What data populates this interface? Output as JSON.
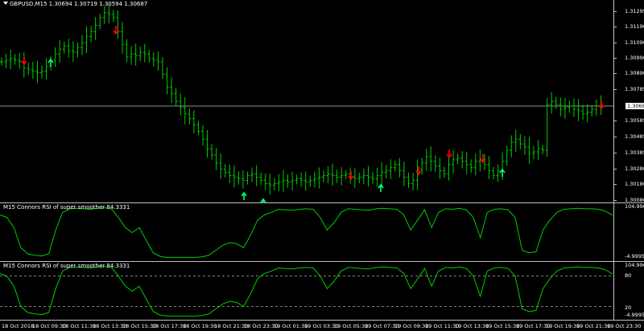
{
  "main_chart": {
    "title": "GBPUSD,M15  1.30694 1.30719 1.30594 1.30687",
    "current_price": "1.30687",
    "y_ticks": [
      "1.31295",
      "1.31190",
      "1.31090",
      "1.30990",
      "1.30890",
      "1.30785",
      "1.30687",
      "1.30585",
      "1.30485",
      "1.30385",
      "1.30280",
      "1.30180",
      "1.30080"
    ],
    "colors": {
      "bars": "#00cc00",
      "sell_arrow": "#ff0000",
      "buy_arrow": "#00ff7f",
      "price_line": "#c0c0c0"
    }
  },
  "indicator_1": {
    "title": "M15 Connors RSI of super smoother 84.3331",
    "y_ticks": [
      "104.9966",
      "-4.9995"
    ],
    "color": "#00cc00"
  },
  "indicator_2": {
    "title": "M15 Connors RSI of super smoother 84.3331",
    "y_ticks": [
      "104.9966",
      "80",
      "20",
      "-4.9995"
    ],
    "color": "#00cc00"
  },
  "x_axis": {
    "labels": [
      "18 Oct 2018",
      "18 Oct 09:30",
      "18 Oct 11:30",
      "18 Oct 13:30",
      "18 Oct 15:30",
      "18 Oct 17:30",
      "18 Oct 19:30",
      "18 Oct 21:30",
      "18 Oct 23:30",
      "19 Oct 01:30",
      "19 Oct 03:30",
      "19 Oct 05:30",
      "19 Oct 07:30",
      "19 Oct 09:30",
      "19 Oct 11:30",
      "19 Oct 13:30",
      "19 Oct 15:30",
      "19 Oct 17:30",
      "19 Oct 19:30",
      "19 Oct 21:30",
      "19 Oct 23:30"
    ]
  },
  "chart_data": [
    {
      "type": "ohlc",
      "series": [
        {
          "name": "GBPUSD,M15",
          "values": [
            1.3096,
            1.3097,
            1.3098,
            1.3097,
            1.3096,
            1.3092,
            1.3091,
            1.309,
            1.3089,
            1.309,
            1.3093,
            1.3097,
            1.3101,
            1.3104,
            1.3106,
            1.3103,
            1.3102,
            1.3105,
            1.3108,
            1.3112,
            1.3115,
            1.3119,
            1.3124,
            1.3127,
            1.3126,
            1.3124,
            1.3115,
            1.3107,
            1.3099,
            1.3101,
            1.31,
            1.3102,
            1.3101,
            1.3098,
            1.3097,
            1.3096,
            1.3088,
            1.308,
            1.3076,
            1.3071,
            1.3067,
            1.3063,
            1.306,
            1.3056,
            1.3052,
            1.3047,
            1.3041,
            1.3037,
            1.3032,
            1.3028,
            1.3026,
            1.3024,
            1.3023,
            1.3022,
            1.3021,
            1.3024,
            1.3025,
            1.3023,
            1.3021,
            1.3019,
            1.3018,
            1.3019,
            1.302,
            1.3021,
            1.302,
            1.3021,
            1.3022,
            1.3021,
            1.302,
            1.3021,
            1.3022,
            1.3023,
            1.3024,
            1.3025,
            1.3024,
            1.3023,
            1.3024,
            1.3025,
            1.3023,
            1.3022,
            1.3023,
            1.3024,
            1.3023,
            1.3022,
            1.3024,
            1.3026,
            1.3027,
            1.3029,
            1.3031,
            1.3027,
            1.3023,
            1.3019,
            1.3021,
            1.3028,
            1.3032,
            1.3036,
            1.3033,
            1.303,
            1.3027,
            1.3025,
            1.3031,
            1.3034,
            1.3035,
            1.3033,
            1.3031,
            1.3029,
            1.3033,
            1.3034,
            1.3031,
            1.3027,
            1.3024,
            1.3027,
            1.3033,
            1.304,
            1.3045,
            1.3047,
            1.3044,
            1.3042,
            1.3038,
            1.3039,
            1.3041,
            1.304,
            1.3069,
            1.3071,
            1.3069,
            1.3066,
            1.3067,
            1.3068,
            1.3066,
            1.3065,
            1.3063,
            1.3064,
            1.3066,
            1.3068,
            1.3069
          ]
        }
      ]
    },
    {
      "type": "line",
      "series": [
        {
          "name": "M15 Connors RSI of super smoother",
          "values": [
            85,
            80,
            60,
            20,
            8,
            5,
            4,
            8,
            55,
            90,
            97,
            98,
            97,
            96,
            98,
            99,
            97,
            80,
            60,
            50,
            60,
            35,
            10,
            3,
            1,
            1,
            1,
            1,
            1,
            2,
            5,
            15,
            25,
            30,
            28,
            20,
            45,
            75,
            85,
            90,
            96,
            95,
            94,
            96,
            97,
            96,
            80,
            55,
            70,
            90,
            97,
            96,
            95,
            94,
            97,
            98,
            97,
            96,
            85,
            55,
            75,
            95,
            60,
            90,
            97,
            96,
            98,
            95,
            80,
            40,
            90,
            96,
            97,
            95,
            80,
            15,
            10,
            12,
            55,
            75,
            90,
            96,
            97,
            98,
            97,
            97,
            96,
            92,
            84
          ]
        }
      ]
    },
    {
      "type": "line",
      "series": [
        {
          "name": "M15 Connors RSI of super smoother",
          "values": [
            85,
            80,
            60,
            20,
            8,
            5,
            4,
            8,
            55,
            90,
            97,
            98,
            97,
            96,
            98,
            99,
            97,
            80,
            60,
            50,
            60,
            35,
            10,
            3,
            1,
            1,
            1,
            1,
            1,
            2,
            5,
            15,
            25,
            30,
            28,
            20,
            45,
            75,
            85,
            90,
            96,
            95,
            94,
            96,
            97,
            96,
            80,
            55,
            70,
            90,
            97,
            96,
            95,
            94,
            97,
            98,
            97,
            96,
            85,
            55,
            75,
            95,
            60,
            90,
            97,
            96,
            98,
            95,
            80,
            40,
            90,
            96,
            97,
            95,
            80,
            15,
            10,
            12,
            55,
            75,
            90,
            96,
            97,
            98,
            97,
            97,
            96,
            92,
            84
          ]
        }
      ]
    }
  ]
}
